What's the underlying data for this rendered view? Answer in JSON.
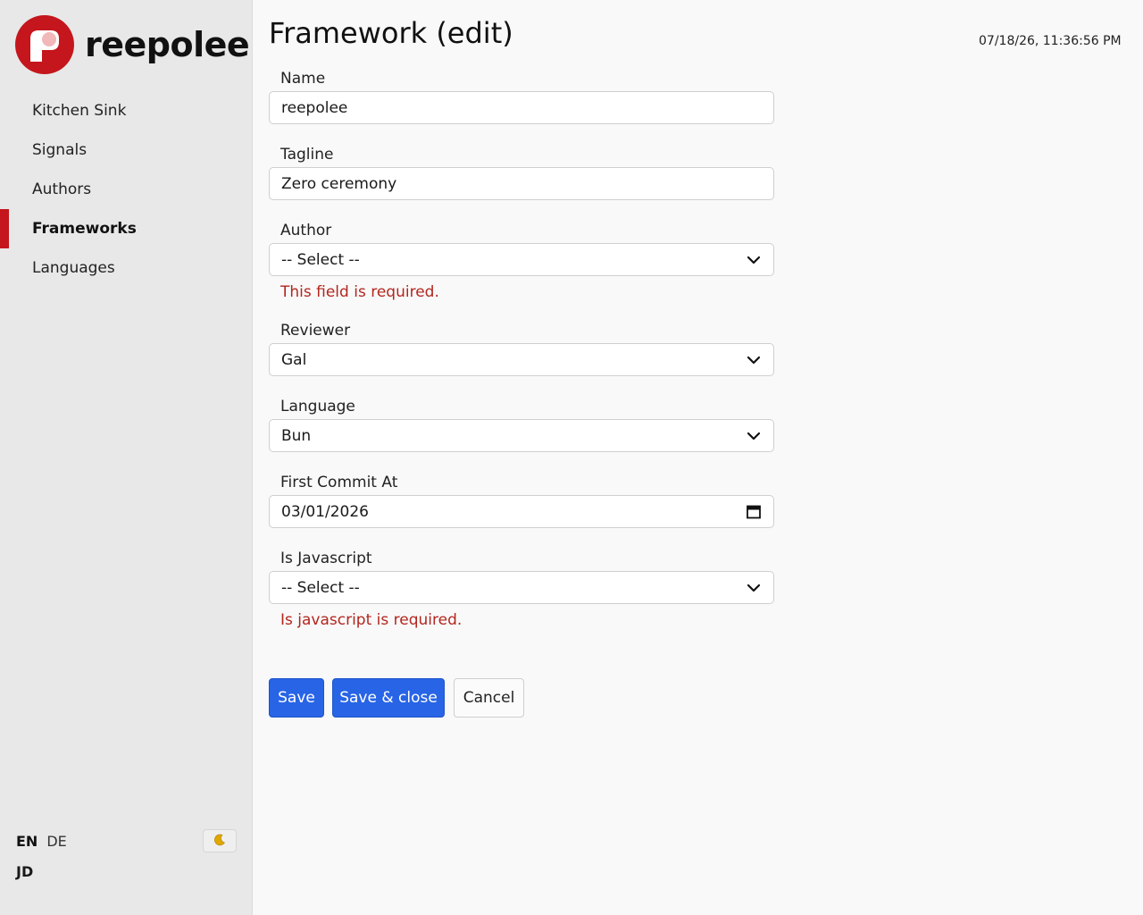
{
  "brand": {
    "name": "reepolee",
    "logo_icon": "reepolee-logo-icon",
    "color": "#c4161c"
  },
  "sidebar": {
    "items": [
      {
        "label": "Kitchen Sink",
        "active": false
      },
      {
        "label": "Signals",
        "active": false
      },
      {
        "label": "Authors",
        "active": false
      },
      {
        "label": "Frameworks",
        "active": true
      },
      {
        "label": "Languages",
        "active": false
      }
    ],
    "languages": [
      {
        "label": "EN",
        "active": true
      },
      {
        "label": "DE",
        "active": false
      }
    ],
    "theme_toggle_icon": "moon-icon",
    "user_initials": "JD"
  },
  "header": {
    "title": "Framework (edit)",
    "timestamp": "07/18/26, 11:36:56 PM"
  },
  "form": {
    "name": {
      "label": "Name",
      "value": "reepolee"
    },
    "tagline": {
      "label": "Tagline",
      "value": "Zero ceremony"
    },
    "author": {
      "label": "Author",
      "value": "-- Select --",
      "error": "This field is required."
    },
    "reviewer": {
      "label": "Reviewer",
      "value": "Gal"
    },
    "language": {
      "label": "Language",
      "value": "Bun"
    },
    "first_commit_at": {
      "label": "First Commit At",
      "value": "03/01/2026"
    },
    "is_javascript": {
      "label": "Is Javascript",
      "value": "-- Select --",
      "error": "Is javascript is required."
    }
  },
  "actions": {
    "save_label": "Save",
    "save_close_label": "Save & close",
    "cancel_label": "Cancel",
    "primary_color": "#2864e6"
  }
}
